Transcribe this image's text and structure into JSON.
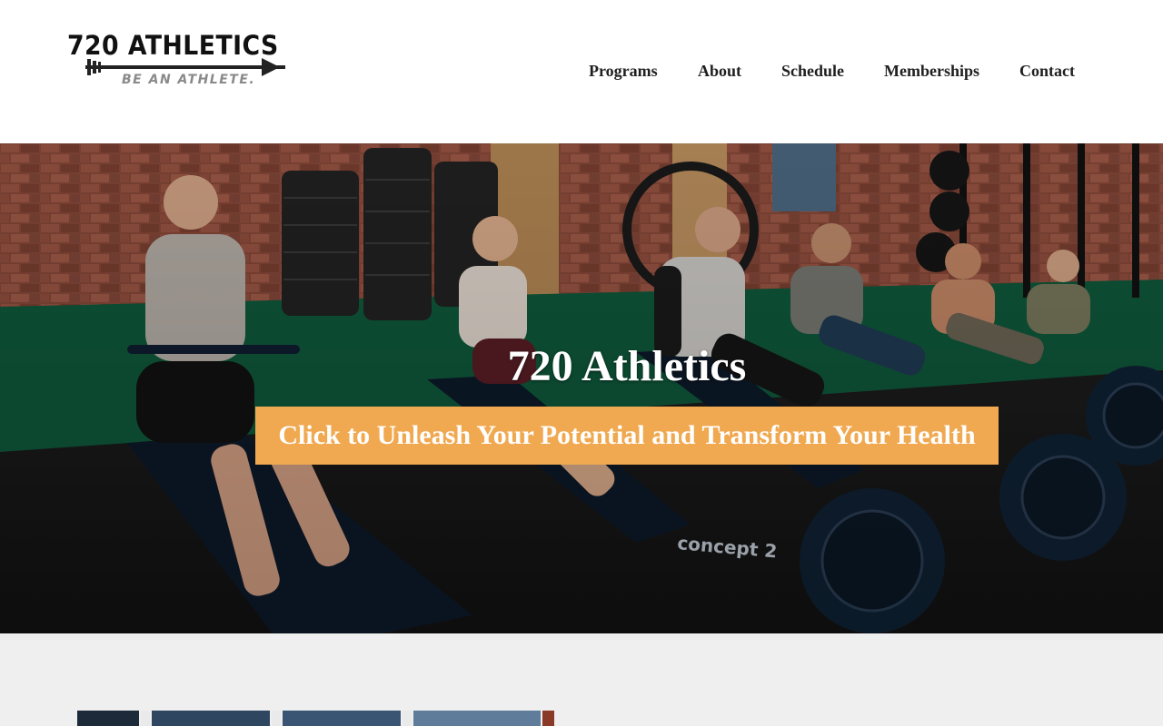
{
  "brand": {
    "name": "720 ATHLETICS",
    "tagline": "BE AN ATHLETE."
  },
  "nav": {
    "items": [
      {
        "label": "Programs"
      },
      {
        "label": "About"
      },
      {
        "label": "Schedule"
      },
      {
        "label": "Memberships"
      },
      {
        "label": "Contact"
      }
    ]
  },
  "hero": {
    "title": "720 Athletics",
    "cta_label": "Click to Unleash Your Potential and Transform Your Health",
    "cta_color": "#f0a950",
    "image_description_icon": "rowing-class-photo",
    "equipment_brand_text": "concept 2"
  },
  "colors": {
    "header_bg": "#ffffff",
    "nav_text": "#1f1f1f",
    "section_bg": "#efefef"
  }
}
